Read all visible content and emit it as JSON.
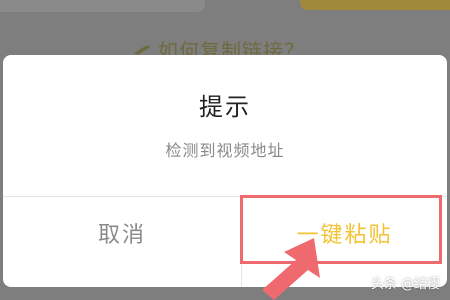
{
  "background": {
    "howto_text": "如何复制链接？",
    "howto_icon": "hand-pointing-icon"
  },
  "dialog": {
    "title": "提示",
    "message": "检测到视频地址",
    "cancel_label": "取消",
    "paste_label": "一键粘贴"
  },
  "annotation": {
    "highlight_color": "#ef6a6f",
    "arrow_icon": "pointer-arrow-icon"
  },
  "watermark": {
    "text": "头条 @结樱"
  },
  "colors": {
    "accent": "#f4c232",
    "overlay": "#7e7e7e"
  }
}
